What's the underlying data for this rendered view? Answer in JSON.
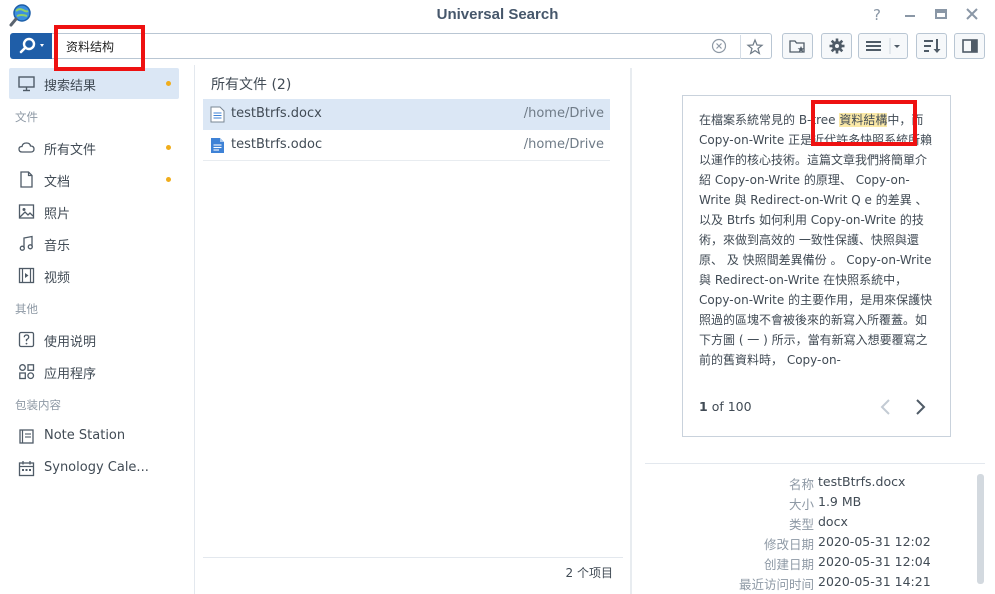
{
  "window": {
    "title": "Universal Search",
    "icon": "magnifier-globe-icon",
    "controls": [
      "help-icon",
      "minimize-icon",
      "maximize-icon",
      "close-icon"
    ]
  },
  "search": {
    "value": "资料结构",
    "accent_color": "#1f5ea8"
  },
  "toolbar": {
    "buttons": [
      "saved-searches-icon",
      "settings-icon",
      "view-menu-icon",
      "sort-icon",
      "preview-panel-icon"
    ]
  },
  "sidebar": {
    "items": [
      {
        "label": "搜索结果",
        "icon": "monitor-icon",
        "active": true,
        "dot": true
      },
      {
        "section": "文件"
      },
      {
        "label": "所有文件",
        "icon": "cloud-icon",
        "dot": true
      },
      {
        "label": "文档",
        "icon": "document-icon",
        "dot": true
      },
      {
        "label": "照片",
        "icon": "image-icon"
      },
      {
        "label": "音乐",
        "icon": "music-icon"
      },
      {
        "label": "视频",
        "icon": "video-icon"
      },
      {
        "section": "其他"
      },
      {
        "label": "使用说明",
        "icon": "help-icon"
      },
      {
        "label": "应用程序",
        "icon": "apps-icon"
      },
      {
        "section": "包装内容"
      },
      {
        "label": "Note Station",
        "icon": "note-icon"
      },
      {
        "label": "Synology Cale...",
        "icon": "calendar-icon"
      }
    ],
    "dot_color": "#f0ad1c"
  },
  "results": {
    "title": "所有文件 (2)",
    "rows": [
      {
        "name": "testBtrfs.docx",
        "path": "/home/Drive",
        "icon": "docx-file-icon",
        "selected": true
      },
      {
        "name": "testBtrfs.odoc",
        "path": "/home/Drive",
        "icon": "odoc-file-icon",
        "selected": false
      }
    ],
    "count": "2 个项目"
  },
  "preview": {
    "text_before": "在檔案系統常見的 B-tree ",
    "highlight": "資料結構",
    "text_after": "中，而 Copy-on-Write 正是近代許多快照系統所賴以運作的核心技術。這篇文章我們將簡單介紹 Copy-on-Write 的原理、 Copy-on-Write 與 Redirect-on-Writ Q e 的差異 、以及 Btrfs 如何利用 Copy-on-Write 的技術，來做到高效的 一致性保護、快照與還原、 及 快照間差異備份 。 Copy-on-Write 與 Redirect-on-Write 在快照系統中， Copy-on-Write 的主要作用，是用來保護快照過的區塊不會被後來的新寫入所覆蓋。如下方圖 ( 一 ) 所示，當有新寫入想要覆寫之前的舊資料時， Copy-on-",
    "page_current": "1",
    "page_of": "of 100"
  },
  "details": [
    {
      "key": "名称",
      "value": "testBtrfs.docx"
    },
    {
      "key": "大小",
      "value": "1.9 MB"
    },
    {
      "key": "类型",
      "value": "docx"
    },
    {
      "key": "修改日期",
      "value": "2020-05-31 12:02"
    },
    {
      "key": "创建日期",
      "value": "2020-05-31 12:04"
    },
    {
      "key": "最近访问时间",
      "value": "2020-05-31 14:21"
    }
  ],
  "annotation_color": "#ee1111"
}
